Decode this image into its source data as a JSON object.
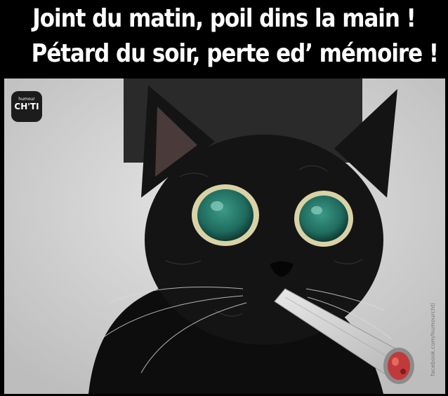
{
  "caption": {
    "line1": "Joint du matin, poil dins la main !",
    "line2": "Pétard du soir, perte ed’ mémoire !"
  },
  "logo": {
    "small_text": "humour",
    "big_text": "CH'TI"
  },
  "watermark": {
    "text": "facebook.com/humourchti"
  },
  "photo": {
    "subject": "black-cat-with-joint",
    "colors": {
      "background_wall": "#d9d9d9",
      "cat_fur": "#111111",
      "eye_iris": "#1f6b5e",
      "eye_ring": "#c9c49a",
      "joint_paper": "#cfcfcf",
      "ember": "#c0393b"
    }
  }
}
